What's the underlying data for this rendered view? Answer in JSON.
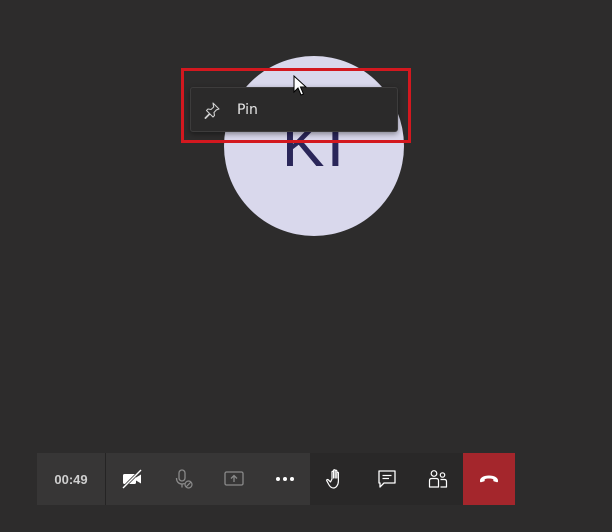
{
  "participant": {
    "initials": "KI"
  },
  "context_menu": {
    "items": [
      {
        "label": "Pin",
        "icon": "pin-icon"
      }
    ]
  },
  "toolbar": {
    "timer": "00:49",
    "buttons": [
      {
        "name": "camera-off-button",
        "icon": "camera-off-icon"
      },
      {
        "name": "mic-muted-button",
        "icon": "mic-off-icon"
      },
      {
        "name": "share-screen-button",
        "icon": "share-screen-icon"
      },
      {
        "name": "more-actions-button",
        "icon": "more-dots-icon"
      },
      {
        "name": "raise-hand-button",
        "icon": "raise-hand-icon"
      },
      {
        "name": "chat-button",
        "icon": "chat-icon"
      },
      {
        "name": "participants-button",
        "icon": "participants-icon"
      },
      {
        "name": "hang-up-button",
        "icon": "hang-up-icon"
      }
    ]
  },
  "colors": {
    "background": "#2d2c2c",
    "avatar": "#d9d8ec",
    "initials": "#2a2659",
    "highlight": "#d3181f",
    "hangup": "#a4262c"
  }
}
